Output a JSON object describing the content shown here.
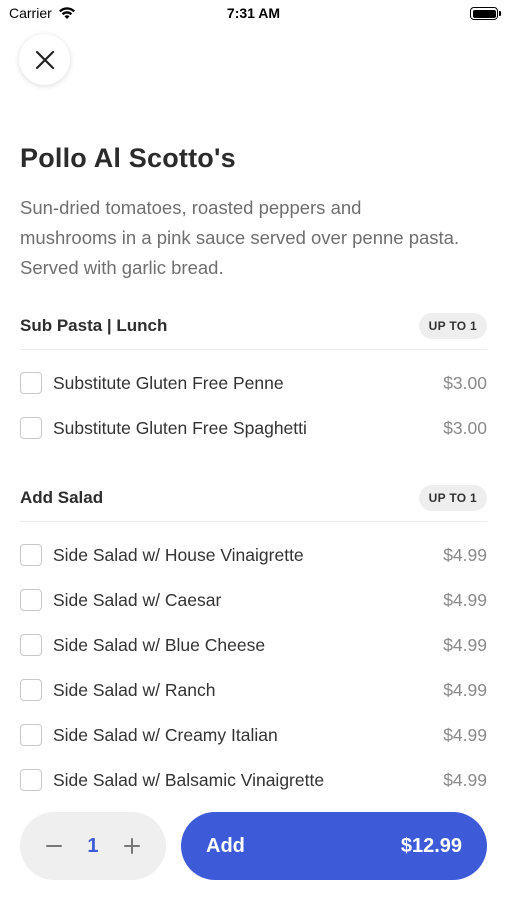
{
  "status_bar": {
    "carrier": "Carrier",
    "time": "7:31 AM"
  },
  "item": {
    "title": "Pollo Al Scotto's",
    "description": "Sun-dried tomatoes, roasted peppers and mushrooms in a pink sauce served over penne pasta. Served with garlic bread."
  },
  "sections": [
    {
      "title": "Sub Pasta | Lunch",
      "badge": "UP TO 1",
      "options": [
        {
          "label": "Substitute Gluten Free Penne",
          "price": "$3.00",
          "checked": false
        },
        {
          "label": "Substitute Gluten Free Spaghetti",
          "price": "$3.00",
          "checked": false
        }
      ]
    },
    {
      "title": "Add Salad",
      "badge": "UP TO 1",
      "options": [
        {
          "label": "Side Salad w/ House Vinaigrette",
          "price": "$4.99",
          "checked": false
        },
        {
          "label": "Side Salad w/ Caesar",
          "price": "$4.99",
          "checked": false
        },
        {
          "label": "Side Salad w/ Blue Cheese",
          "price": "$4.99",
          "checked": false
        },
        {
          "label": "Side Salad w/ Ranch",
          "price": "$4.99",
          "checked": false
        },
        {
          "label": "Side Salad w/ Creamy Italian",
          "price": "$4.99",
          "checked": false
        },
        {
          "label": "Side Salad w/ Balsamic Vinaigrette",
          "price": "$4.99",
          "checked": false
        }
      ]
    }
  ],
  "footer": {
    "quantity": "1",
    "minus_icon": "minus-icon",
    "plus_icon": "plus-icon",
    "add_label": "Add",
    "total": "$12.99"
  },
  "colors": {
    "accent": "#3d5bd9"
  }
}
